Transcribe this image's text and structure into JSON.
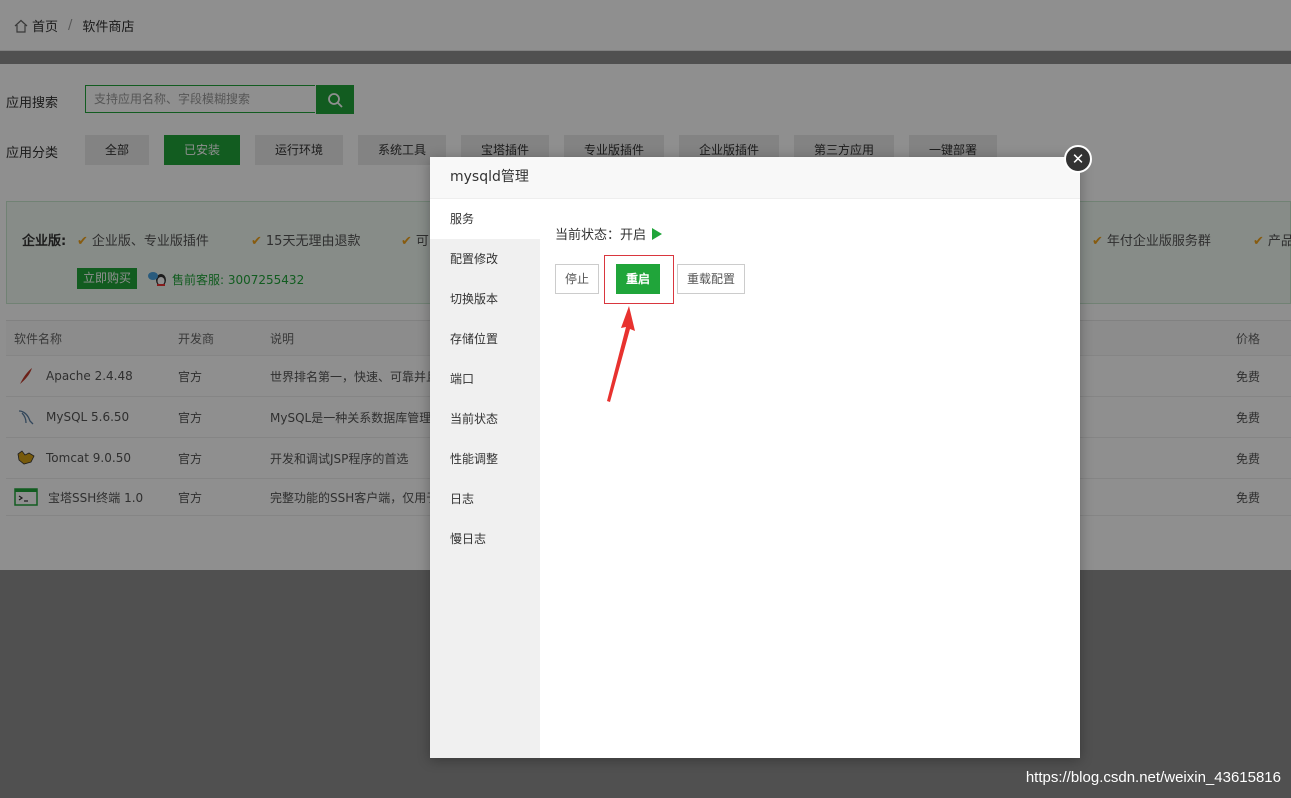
{
  "breadcrumb": {
    "home": "首页",
    "separator": "/",
    "current": "软件商店"
  },
  "search": {
    "label": "应用搜索",
    "placeholder": "支持应用名称、字段模糊搜索"
  },
  "categories": {
    "label": "应用分类",
    "items": [
      "全部",
      "已安装",
      "运行环境",
      "系统工具",
      "宝塔插件",
      "专业版插件",
      "企业版插件",
      "第三方应用",
      "一键部署"
    ],
    "active": "已安装"
  },
  "promo": {
    "label": "企业版:",
    "features": [
      "企业版、专业版插件",
      "15天无理由退款",
      "可",
      "年付企业版服务群",
      "产品"
    ],
    "buy_label": "立即购买",
    "service": "售前客服: 3007255432"
  },
  "table": {
    "headers": [
      "软件名称",
      "开发商",
      "说明",
      "价格"
    ],
    "rows": [
      {
        "name": "Apache 2.4.48",
        "dev": "官方",
        "desc": "世界排名第一，快速、可靠并且",
        "price": "免费",
        "icon": "apache-feather-icon"
      },
      {
        "name": "MySQL 5.6.50",
        "dev": "官方",
        "desc": "MySQL是一种关系数据库管理",
        "price": "免费",
        "icon": "mysql-dolphin-icon"
      },
      {
        "name": "Tomcat 9.0.50",
        "dev": "官方",
        "desc": "开发和调试JSP程序的首选",
        "price": "免费",
        "icon": "tomcat-cat-icon"
      },
      {
        "name": "宝塔SSH终端 1.0",
        "dev": "官方",
        "desc": "完整功能的SSH客户端，仅用于",
        "price": "免费",
        "icon": "terminal-icon"
      }
    ]
  },
  "modal": {
    "title": "mysqld管理",
    "sidebar": [
      "服务",
      "配置修改",
      "切换版本",
      "存储位置",
      "端口",
      "当前状态",
      "性能调整",
      "日志",
      "慢日志"
    ],
    "active_tab": "服务",
    "status_label": "当前状态：开启",
    "buttons": {
      "stop": "停止",
      "restart": "重启",
      "reload": "重载配置"
    }
  },
  "colors": {
    "accent": "#20a53a",
    "highlight": "#d9363e",
    "warning": "#f0a31b"
  },
  "watermark": "https://blog.csdn.net/weixin_43615816"
}
